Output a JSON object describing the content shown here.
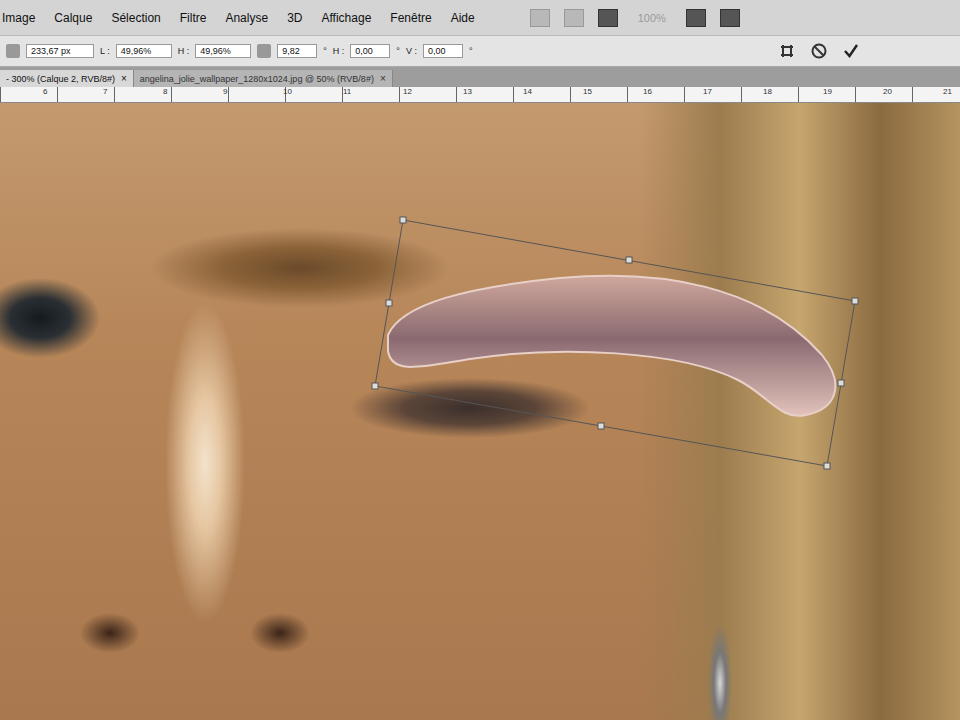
{
  "menu": [
    "Image",
    "Calque",
    "Sélection",
    "Filtre",
    "Analyse",
    "3D",
    "Affichage",
    "Fenêtre",
    "Aide"
  ],
  "toolbar": {
    "zoom": "100%",
    "zoom_disabled": true
  },
  "options": {
    "position": "233,67 px",
    "scale": [
      {
        "label": "L :",
        "value": "49,96%"
      },
      {
        "label": "H :",
        "value": "49,96%"
      }
    ],
    "angle": "9,82",
    "degree": "°",
    "skew": [
      {
        "label": "H :",
        "value": "0,00"
      },
      {
        "label": "V :",
        "value": "0,00"
      }
    ]
  },
  "tabs": [
    {
      "label": "- 300% (Calque 2, RVB/8#)",
      "close": "×",
      "selected": true
    },
    {
      "label": "angelina_jolie_wallpaper_1280x1024.jpg @ 50% (RVB/8#)",
      "close": "×",
      "selected": false
    }
  ],
  "ruler": [
    "6",
    "7",
    "8",
    "9",
    "10",
    "11",
    "12",
    "13",
    "14",
    "15",
    "16",
    "17",
    "18",
    "19",
    "20",
    "21"
  ],
  "canvas": {
    "transform_active": true
  }
}
